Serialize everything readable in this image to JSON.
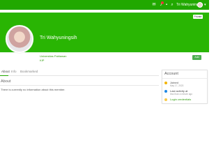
{
  "topbar": {
    "username": "Tri Wahyuningsih",
    "icons": [
      "mail-icon",
      "bell-icon",
      "chat-icon",
      "search-icon",
      "chevron-down-icon"
    ],
    "brand_color": "#21a800"
  },
  "cover": {
    "private_label": "Private",
    "name": "Tri Wahyuningsih",
    "color": "#29b503"
  },
  "profile": {
    "university": "Universitas Pahlawan",
    "role": "KIP",
    "add_label": "Add"
  },
  "tabs": [
    {
      "label": "About"
    },
    {
      "label": "Info"
    },
    {
      "label": "Bookmarked"
    }
  ],
  "about": {
    "title": "About",
    "empty_message": "There is currently no information about this member."
  },
  "account": {
    "title": "Account",
    "joined_label": "Joined",
    "joined_value": "May 17, 2023",
    "last_activity_label": "Last activity at",
    "last_activity_value": "less than a minute ago",
    "login_label": "Login credentials"
  }
}
